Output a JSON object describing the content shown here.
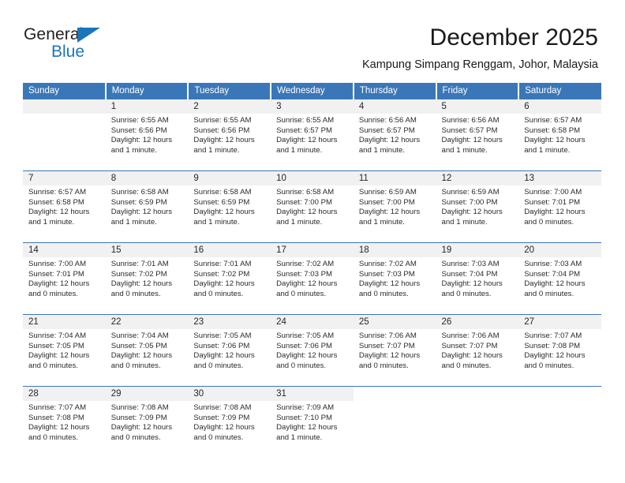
{
  "logo": {
    "word_top": "General",
    "word_bottom": "Blue",
    "triangle_color": "#1b75bb"
  },
  "header": {
    "title": "December 2025",
    "subtitle": "Kampung Simpang Renggam, Johor, Malaysia"
  },
  "theme": {
    "header_blue": "#3a77b8",
    "daynum_band": "#f1f1f1",
    "text": "#2b2b2b"
  },
  "calendar": {
    "weekday_headers": [
      "Sunday",
      "Monday",
      "Tuesday",
      "Wednesday",
      "Thursday",
      "Friday",
      "Saturday"
    ],
    "weeks": [
      [
        {
          "day": "",
          "sunrise": "",
          "sunset": "",
          "daylight": "",
          "daylight2": "",
          "empty": true
        },
        {
          "day": "1",
          "sunrise": "Sunrise: 6:55 AM",
          "sunset": "Sunset: 6:56 PM",
          "daylight": "Daylight: 12 hours",
          "daylight2": "and 1 minute."
        },
        {
          "day": "2",
          "sunrise": "Sunrise: 6:55 AM",
          "sunset": "Sunset: 6:56 PM",
          "daylight": "Daylight: 12 hours",
          "daylight2": "and 1 minute."
        },
        {
          "day": "3",
          "sunrise": "Sunrise: 6:55 AM",
          "sunset": "Sunset: 6:57 PM",
          "daylight": "Daylight: 12 hours",
          "daylight2": "and 1 minute."
        },
        {
          "day": "4",
          "sunrise": "Sunrise: 6:56 AM",
          "sunset": "Sunset: 6:57 PM",
          "daylight": "Daylight: 12 hours",
          "daylight2": "and 1 minute."
        },
        {
          "day": "5",
          "sunrise": "Sunrise: 6:56 AM",
          "sunset": "Sunset: 6:57 PM",
          "daylight": "Daylight: 12 hours",
          "daylight2": "and 1 minute."
        },
        {
          "day": "6",
          "sunrise": "Sunrise: 6:57 AM",
          "sunset": "Sunset: 6:58 PM",
          "daylight": "Daylight: 12 hours",
          "daylight2": "and 1 minute."
        }
      ],
      [
        {
          "day": "7",
          "sunrise": "Sunrise: 6:57 AM",
          "sunset": "Sunset: 6:58 PM",
          "daylight": "Daylight: 12 hours",
          "daylight2": "and 1 minute."
        },
        {
          "day": "8",
          "sunrise": "Sunrise: 6:58 AM",
          "sunset": "Sunset: 6:59 PM",
          "daylight": "Daylight: 12 hours",
          "daylight2": "and 1 minute."
        },
        {
          "day": "9",
          "sunrise": "Sunrise: 6:58 AM",
          "sunset": "Sunset: 6:59 PM",
          "daylight": "Daylight: 12 hours",
          "daylight2": "and 1 minute."
        },
        {
          "day": "10",
          "sunrise": "Sunrise: 6:58 AM",
          "sunset": "Sunset: 7:00 PM",
          "daylight": "Daylight: 12 hours",
          "daylight2": "and 1 minute."
        },
        {
          "day": "11",
          "sunrise": "Sunrise: 6:59 AM",
          "sunset": "Sunset: 7:00 PM",
          "daylight": "Daylight: 12 hours",
          "daylight2": "and 1 minute."
        },
        {
          "day": "12",
          "sunrise": "Sunrise: 6:59 AM",
          "sunset": "Sunset: 7:00 PM",
          "daylight": "Daylight: 12 hours",
          "daylight2": "and 1 minute."
        },
        {
          "day": "13",
          "sunrise": "Sunrise: 7:00 AM",
          "sunset": "Sunset: 7:01 PM",
          "daylight": "Daylight: 12 hours",
          "daylight2": "and 0 minutes."
        }
      ],
      [
        {
          "day": "14",
          "sunrise": "Sunrise: 7:00 AM",
          "sunset": "Sunset: 7:01 PM",
          "daylight": "Daylight: 12 hours",
          "daylight2": "and 0 minutes."
        },
        {
          "day": "15",
          "sunrise": "Sunrise: 7:01 AM",
          "sunset": "Sunset: 7:02 PM",
          "daylight": "Daylight: 12 hours",
          "daylight2": "and 0 minutes."
        },
        {
          "day": "16",
          "sunrise": "Sunrise: 7:01 AM",
          "sunset": "Sunset: 7:02 PM",
          "daylight": "Daylight: 12 hours",
          "daylight2": "and 0 minutes."
        },
        {
          "day": "17",
          "sunrise": "Sunrise: 7:02 AM",
          "sunset": "Sunset: 7:03 PM",
          "daylight": "Daylight: 12 hours",
          "daylight2": "and 0 minutes."
        },
        {
          "day": "18",
          "sunrise": "Sunrise: 7:02 AM",
          "sunset": "Sunset: 7:03 PM",
          "daylight": "Daylight: 12 hours",
          "daylight2": "and 0 minutes."
        },
        {
          "day": "19",
          "sunrise": "Sunrise: 7:03 AM",
          "sunset": "Sunset: 7:04 PM",
          "daylight": "Daylight: 12 hours",
          "daylight2": "and 0 minutes."
        },
        {
          "day": "20",
          "sunrise": "Sunrise: 7:03 AM",
          "sunset": "Sunset: 7:04 PM",
          "daylight": "Daylight: 12 hours",
          "daylight2": "and 0 minutes."
        }
      ],
      [
        {
          "day": "21",
          "sunrise": "Sunrise: 7:04 AM",
          "sunset": "Sunset: 7:05 PM",
          "daylight": "Daylight: 12 hours",
          "daylight2": "and 0 minutes."
        },
        {
          "day": "22",
          "sunrise": "Sunrise: 7:04 AM",
          "sunset": "Sunset: 7:05 PM",
          "daylight": "Daylight: 12 hours",
          "daylight2": "and 0 minutes."
        },
        {
          "day": "23",
          "sunrise": "Sunrise: 7:05 AM",
          "sunset": "Sunset: 7:06 PM",
          "daylight": "Daylight: 12 hours",
          "daylight2": "and 0 minutes."
        },
        {
          "day": "24",
          "sunrise": "Sunrise: 7:05 AM",
          "sunset": "Sunset: 7:06 PM",
          "daylight": "Daylight: 12 hours",
          "daylight2": "and 0 minutes."
        },
        {
          "day": "25",
          "sunrise": "Sunrise: 7:06 AM",
          "sunset": "Sunset: 7:07 PM",
          "daylight": "Daylight: 12 hours",
          "daylight2": "and 0 minutes."
        },
        {
          "day": "26",
          "sunrise": "Sunrise: 7:06 AM",
          "sunset": "Sunset: 7:07 PM",
          "daylight": "Daylight: 12 hours",
          "daylight2": "and 0 minutes."
        },
        {
          "day": "27",
          "sunrise": "Sunrise: 7:07 AM",
          "sunset": "Sunset: 7:08 PM",
          "daylight": "Daylight: 12 hours",
          "daylight2": "and 0 minutes."
        }
      ],
      [
        {
          "day": "28",
          "sunrise": "Sunrise: 7:07 AM",
          "sunset": "Sunset: 7:08 PM",
          "daylight": "Daylight: 12 hours",
          "daylight2": "and 0 minutes."
        },
        {
          "day": "29",
          "sunrise": "Sunrise: 7:08 AM",
          "sunset": "Sunset: 7:09 PM",
          "daylight": "Daylight: 12 hours",
          "daylight2": "and 0 minutes."
        },
        {
          "day": "30",
          "sunrise": "Sunrise: 7:08 AM",
          "sunset": "Sunset: 7:09 PM",
          "daylight": "Daylight: 12 hours",
          "daylight2": "and 0 minutes."
        },
        {
          "day": "31",
          "sunrise": "Sunrise: 7:09 AM",
          "sunset": "Sunset: 7:10 PM",
          "daylight": "Daylight: 12 hours",
          "daylight2": "and 1 minute."
        },
        {
          "day": "",
          "sunrise": "",
          "sunset": "",
          "daylight": "",
          "daylight2": "",
          "blank": true
        },
        {
          "day": "",
          "sunrise": "",
          "sunset": "",
          "daylight": "",
          "daylight2": "",
          "blank": true
        },
        {
          "day": "",
          "sunrise": "",
          "sunset": "",
          "daylight": "",
          "daylight2": "",
          "blank": true
        }
      ]
    ]
  }
}
